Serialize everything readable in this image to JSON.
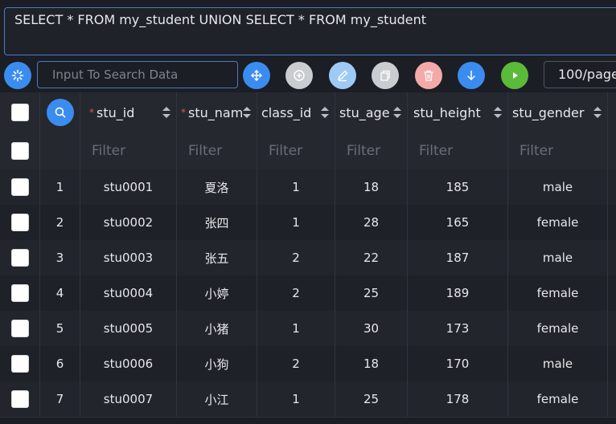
{
  "sql": {
    "query": "SELECT * FROM my_student UNION SELECT * FROM my_student"
  },
  "toolbar": {
    "search_placeholder": "Input To Search Data",
    "page_size": "100/page",
    "buttons": [
      {
        "icon": "refresh-icon",
        "color": "#3b8cf0"
      },
      {
        "icon": "move-icon",
        "color": "#3b8cf0"
      },
      {
        "icon": "add-icon",
        "color": "#c9ccd1"
      },
      {
        "icon": "edit-icon",
        "color": "#9fcaf5"
      },
      {
        "icon": "copy-icon",
        "color": "#c9ccd1"
      },
      {
        "icon": "delete-icon",
        "color": "#f4a9a9"
      },
      {
        "icon": "download-icon",
        "color": "#3b8cf0"
      },
      {
        "icon": "run-icon",
        "color": "#5bba3a"
      }
    ]
  },
  "columns": [
    {
      "label": "stu_id",
      "required": true
    },
    {
      "label": "stu_name",
      "required": true
    },
    {
      "label": "class_id",
      "required": false
    },
    {
      "label": "stu_age",
      "required": false
    },
    {
      "label": "stu_height",
      "required": false
    },
    {
      "label": "stu_gender",
      "required": false
    }
  ],
  "filter_placeholder": "Filter",
  "rows": [
    {
      "n": "1",
      "stu_id": "stu0001",
      "stu_name": "夏洛",
      "class_id": "1",
      "stu_age": "18",
      "stu_height": "185",
      "stu_gender": "male"
    },
    {
      "n": "2",
      "stu_id": "stu0002",
      "stu_name": "张四",
      "class_id": "1",
      "stu_age": "28",
      "stu_height": "165",
      "stu_gender": "female"
    },
    {
      "n": "3",
      "stu_id": "stu0003",
      "stu_name": "张五",
      "class_id": "2",
      "stu_age": "22",
      "stu_height": "187",
      "stu_gender": "male"
    },
    {
      "n": "4",
      "stu_id": "stu0004",
      "stu_name": "小婷",
      "class_id": "2",
      "stu_age": "25",
      "stu_height": "189",
      "stu_gender": "female"
    },
    {
      "n": "5",
      "stu_id": "stu0005",
      "stu_name": "小猪",
      "class_id": "1",
      "stu_age": "30",
      "stu_height": "173",
      "stu_gender": "female"
    },
    {
      "n": "6",
      "stu_id": "stu0006",
      "stu_name": "小狗",
      "class_id": "2",
      "stu_age": "18",
      "stu_height": "170",
      "stu_gender": "male"
    },
    {
      "n": "7",
      "stu_id": "stu0007",
      "stu_name": "小江",
      "class_id": "1",
      "stu_age": "25",
      "stu_height": "178",
      "stu_gender": "female"
    }
  ]
}
